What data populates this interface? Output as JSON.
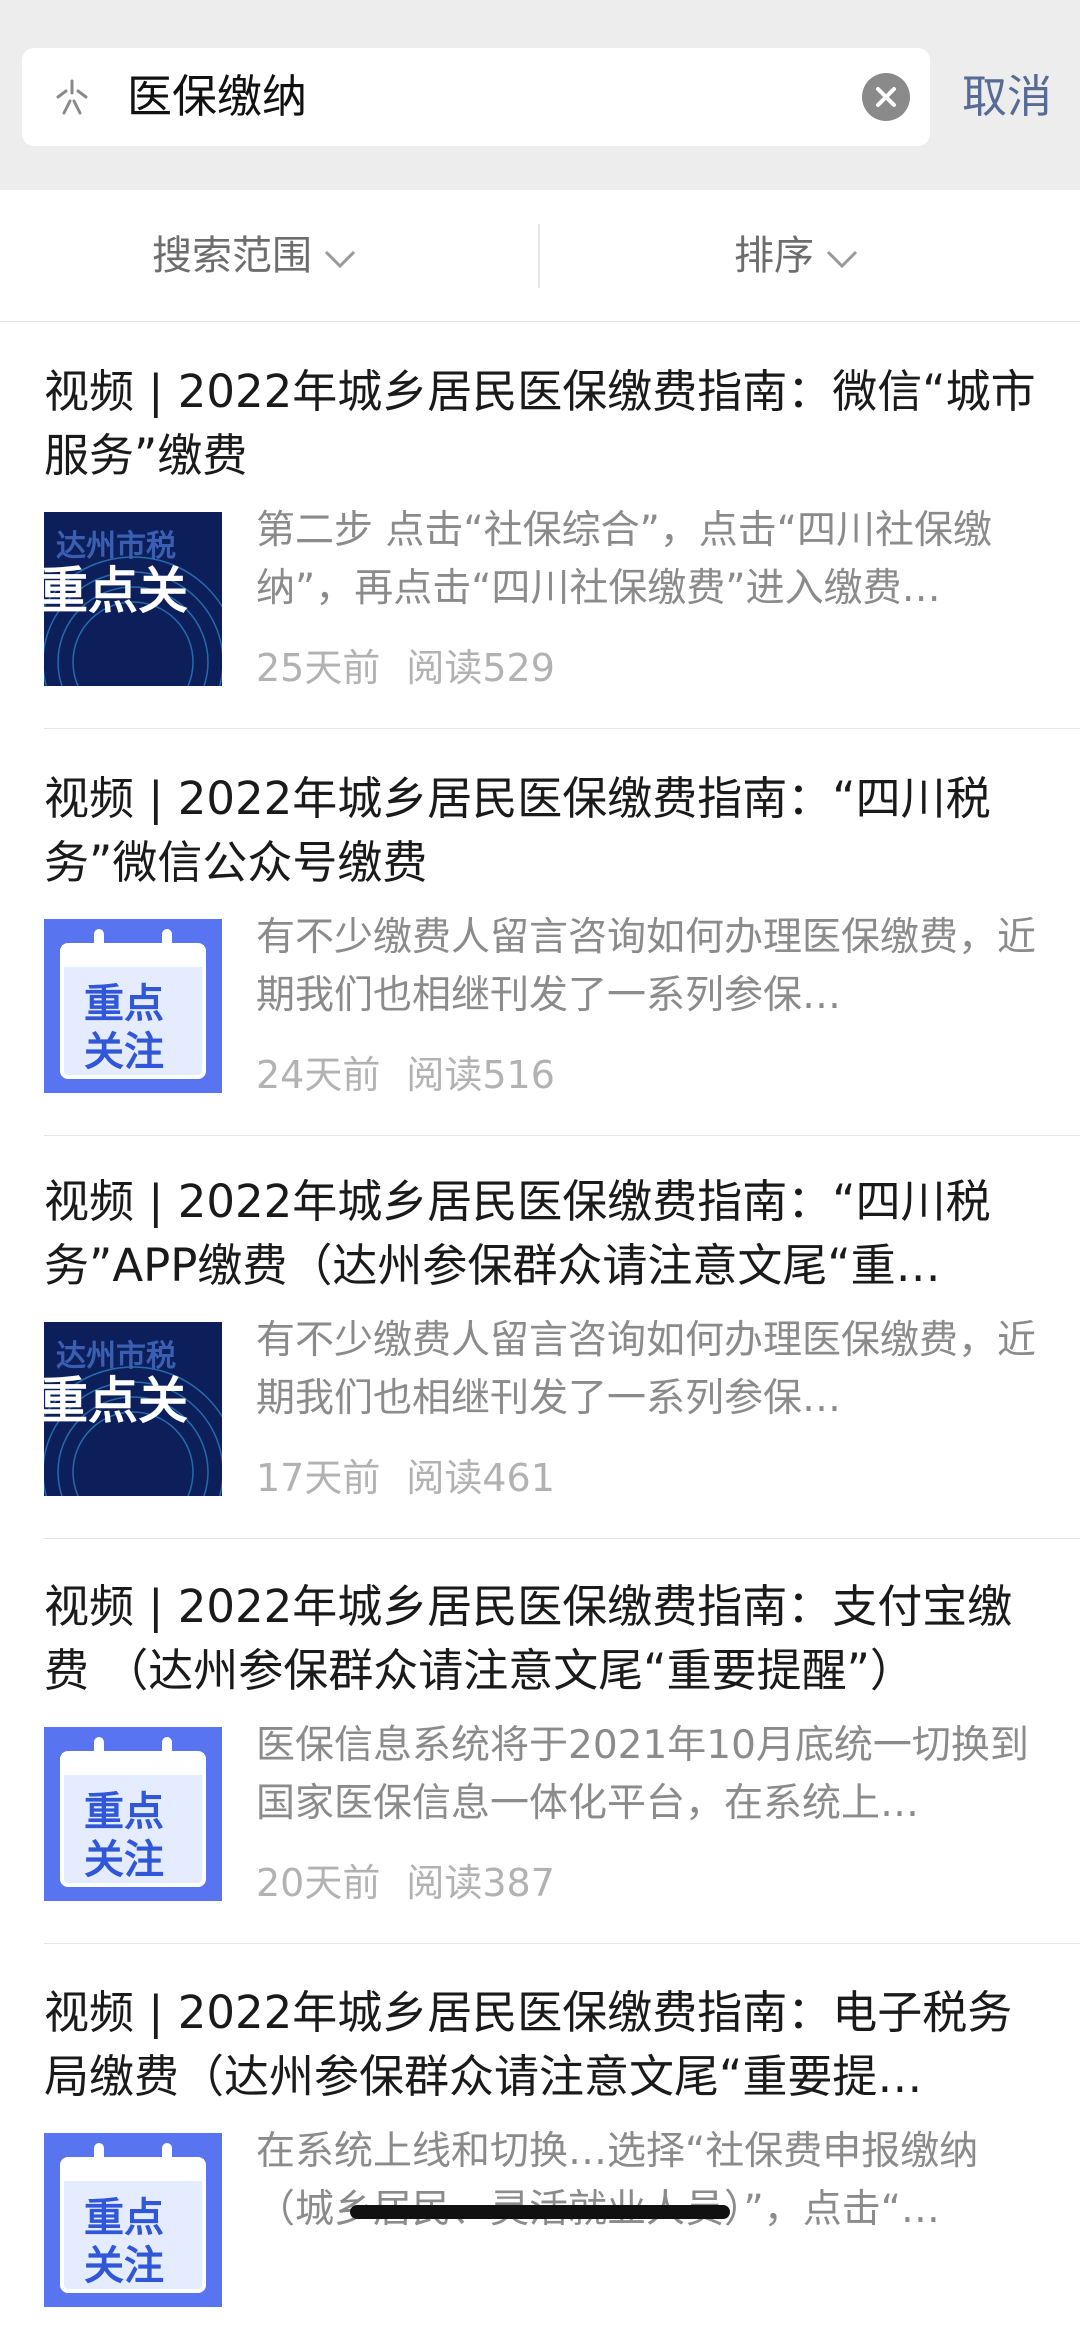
{
  "search": {
    "query": "医保缴纳",
    "cancel_label": "取消"
  },
  "filters": {
    "scope_label": "搜索范围",
    "sort_label": "排序"
  },
  "results": [
    {
      "title": "视频 | 2022年城乡居民医保缴费指南：微信“城市服务”缴费",
      "summary": "第二步 点击“社保综合”，点击“四川社保缴纳”，再点击“四川社保缴费”进入缴费…",
      "time": "25天前",
      "reads": "阅读529",
      "thumb": "dark-banner",
      "thumb_text_top": "达州市税",
      "thumb_text_main": "重点关"
    },
    {
      "title": "视频 | 2022年城乡居民医保缴费指南：“四川税务”微信公众号缴费",
      "summary": "有不少缴费人留言咨询如何办理医保缴费，近期我们也相继刊发了一系列参保…",
      "time": "24天前",
      "reads": "阅读516",
      "thumb": "calendar",
      "thumb_text_a": "重点",
      "thumb_text_b": "关注"
    },
    {
      "title": "视频 | 2022年城乡居民医保缴费指南：“四川税务”APP缴费（达州参保群众请注意文尾“重…",
      "summary": "有不少缴费人留言咨询如何办理医保缴费，近期我们也相继刊发了一系列参保…",
      "time": "17天前",
      "reads": "阅读461",
      "thumb": "dark-banner",
      "thumb_text_top": "达州市税",
      "thumb_text_main": "重点关"
    },
    {
      "title": "视频 | 2022年城乡居民医保缴费指南：支付宝缴费 （达州参保群众请注意文尾“重要提醒”）",
      "summary": "医保信息系统将于2021年10月底统一切换到国家医保信息一体化平台，在系统上…",
      "time": "20天前",
      "reads": "阅读387",
      "thumb": "calendar",
      "thumb_text_a": "重点",
      "thumb_text_b": "关注"
    },
    {
      "title": "视频 | 2022年城乡居民医保缴费指南：电子税务局缴费（达州参保群众请注意文尾“重要提…",
      "summary": "在系统上线和切换…选择“社保费申报缴纳（城乡居民、灵活就业人员）”，点击“…",
      "time": "",
      "reads": "",
      "thumb": "calendar",
      "thumb_text_a": "重点",
      "thumb_text_b": "关注"
    }
  ],
  "colors": {
    "accent": "#576b95",
    "header_bg": "#ededed",
    "title_text": "#1a1a1a",
    "summary_text": "#8b8b8b",
    "meta_text": "#b2b2b2",
    "thumb_dark": "#0d1f5a",
    "thumb_blue": "#5874f0"
  }
}
